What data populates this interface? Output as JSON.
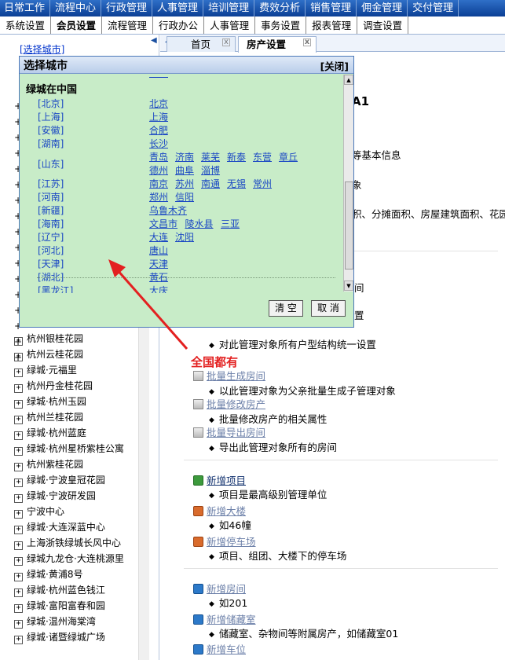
{
  "topnav": [
    "日常工作",
    "流程中心",
    "行政管理",
    "人事管理",
    "培训管理",
    "费效分析",
    "销售管理",
    "佣金管理",
    "交付管理"
  ],
  "subnav": [
    "系统设置",
    "会员设置",
    "流程管理",
    "行政办公",
    "人事管理",
    "事务设置",
    "报表管理",
    "调查设置"
  ],
  "subnav_active": "会员设置",
  "left": {
    "select_city": "[选择城市]",
    "tree": [
      "杭州银桂花园",
      "杭州云桂花园",
      "绿城·元福里",
      "杭州丹金桂花园",
      "绿城·杭州玉园",
      "杭州兰桂花园",
      "绿城·杭州蓝庭",
      "绿城·杭州星桥紫桂公寓",
      "杭州紫桂花园",
      "绿城·宁波皇冠花园",
      "绿城·宁波研发园",
      "宁波中心",
      "绿城·大连深蓝中心",
      "上海浙铁绿城长风中心",
      "绿城九龙仓·大连桃源里",
      "绿城·黄浦8号",
      "绿城·杭州蓝色钱江",
      "绿城·富阳富春和园",
      "绿城·温州海棠湾",
      "绿城·诸暨绿城广场"
    ]
  },
  "tabs": [
    {
      "label": "首页",
      "active": false
    },
    {
      "label": "房产设置",
      "active": true
    }
  ],
  "dialog": {
    "title": "选择城市",
    "close": "[关闭]",
    "heading": "绿城在中国",
    "rows": [
      {
        "province": "[北京]",
        "cities": [
          "北京"
        ]
      },
      {
        "province": "[上海]",
        "cities": [
          "上海"
        ]
      },
      {
        "province": "[安徽]",
        "cities": [
          "合肥"
        ]
      },
      {
        "province": "[湖南]",
        "cities": [
          "长沙"
        ]
      },
      {
        "province": "[山东]",
        "cities": [
          "青岛",
          "济南",
          "莱芜",
          "新泰",
          "东营",
          "章丘",
          "德州",
          "曲阜",
          "淄博"
        ]
      },
      {
        "province": "[江苏]",
        "cities": [
          "南京",
          "苏州",
          "南通",
          "无锡",
          "常州"
        ]
      },
      {
        "province": "[河南]",
        "cities": [
          "郑州",
          "信阳"
        ]
      },
      {
        "province": "[新疆]",
        "cities": [
          "乌鲁木齐"
        ]
      },
      {
        "province": "[海南]",
        "cities": [
          "文昌市",
          "陵水县",
          "三亚"
        ]
      },
      {
        "province": "[辽宁]",
        "cities": [
          "大连",
          "沈阳"
        ]
      },
      {
        "province": "[河北]",
        "cities": [
          "唐山"
        ]
      },
      {
        "province": "[天津]",
        "cities": [
          "天津"
        ]
      },
      {
        "province": "[湖北]",
        "cities": [
          "黄石"
        ]
      },
      {
        "province": "[黑龙江]",
        "cities": [
          "大庆"
        ]
      }
    ],
    "btn_clear": "清 空",
    "btn_cancel": "取 消"
  },
  "annotation": "全国都有",
  "content": {
    "behind": {
      "title_tail": "A1",
      "line1_tail": "等基本信息",
      "line2_tail": "象",
      "line3_tail": "积、分摊面积、房屋建筑面积、花园面",
      "line4_tail": "间",
      "line5_tail": "置"
    },
    "entries": [
      {
        "label": "批量生成房间",
        "desc": "以此管理对象为父亲批量生成子管理对象",
        "icon": "gray"
      },
      {
        "label": "批量修改房产",
        "desc": "批量修改房产的相关属性",
        "icon": "gray"
      },
      {
        "label": "批量导出房间",
        "desc": "导出此管理对象所有的房间",
        "icon": "gray"
      },
      {
        "label": "新增项目",
        "desc": "项目是最高级别管理单位",
        "icon": "green"
      },
      {
        "label": "新增大楼",
        "desc": "如46幢",
        "icon": "orange"
      },
      {
        "label": "新增停车场",
        "desc": "项目、组团、大楼下的停车场",
        "icon": "orange"
      },
      {
        "label": "新增房间",
        "desc": "如201",
        "icon": "blue"
      },
      {
        "label": "新增储藏室",
        "desc": "储藏室、杂物间等附属房产，如储藏室01",
        "icon": "blue"
      },
      {
        "label": "新增车位",
        "desc": "",
        "icon": "blue"
      }
    ],
    "unify_desc": "对此管理对象所有户型结构统一设置"
  }
}
